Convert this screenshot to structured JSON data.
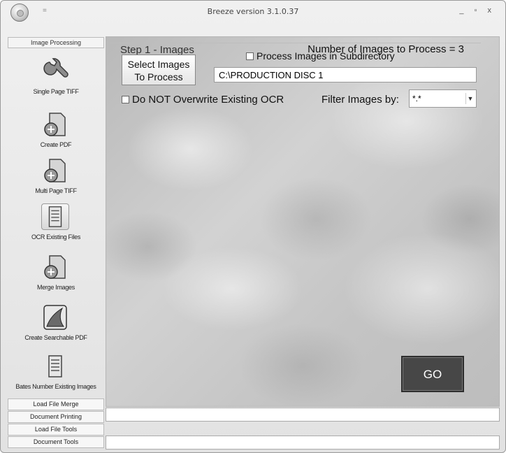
{
  "window": {
    "title": "Breeze version 3.1.0.37",
    "qat_glyph": "=",
    "controls": "_ ▫ x"
  },
  "sidebar": {
    "header": "Image Processing",
    "items": [
      {
        "label": "Single Page TIFF",
        "icon": "wrench-icon"
      },
      {
        "label": "Create PDF",
        "icon": "document-add-icon"
      },
      {
        "label": "Multi Page TIFF",
        "icon": "document-add-icon"
      },
      {
        "label": "OCR Existing Files",
        "icon": "text-document-icon"
      },
      {
        "label": "Merge Images",
        "icon": "document-add-icon"
      },
      {
        "label": "Create Searchable PDF",
        "icon": "pdf-icon"
      },
      {
        "label": "Bates Number Existing Images",
        "icon": "text-document-icon"
      }
    ],
    "sections": [
      "Load File Merge",
      "Document Printing",
      "Load File Tools",
      "Document Tools"
    ]
  },
  "step": {
    "title": "Step 1 - Images",
    "count_label": "Number of Images to Process = 3",
    "select_button_line1": "Select Images",
    "select_button_line2": "To Process",
    "subdirectory_label": "Process Images in Subdirectory",
    "path_value": "C:\\PRODUCTION DISC 1",
    "no_overwrite_label": "Do NOT Overwrite Existing OCR",
    "filter_label": "Filter Images by:",
    "filter_value": "*.*"
  },
  "go_label": "GO",
  "colors": {
    "go_bg": "#474747",
    "frame": "#9a9a9a"
  }
}
